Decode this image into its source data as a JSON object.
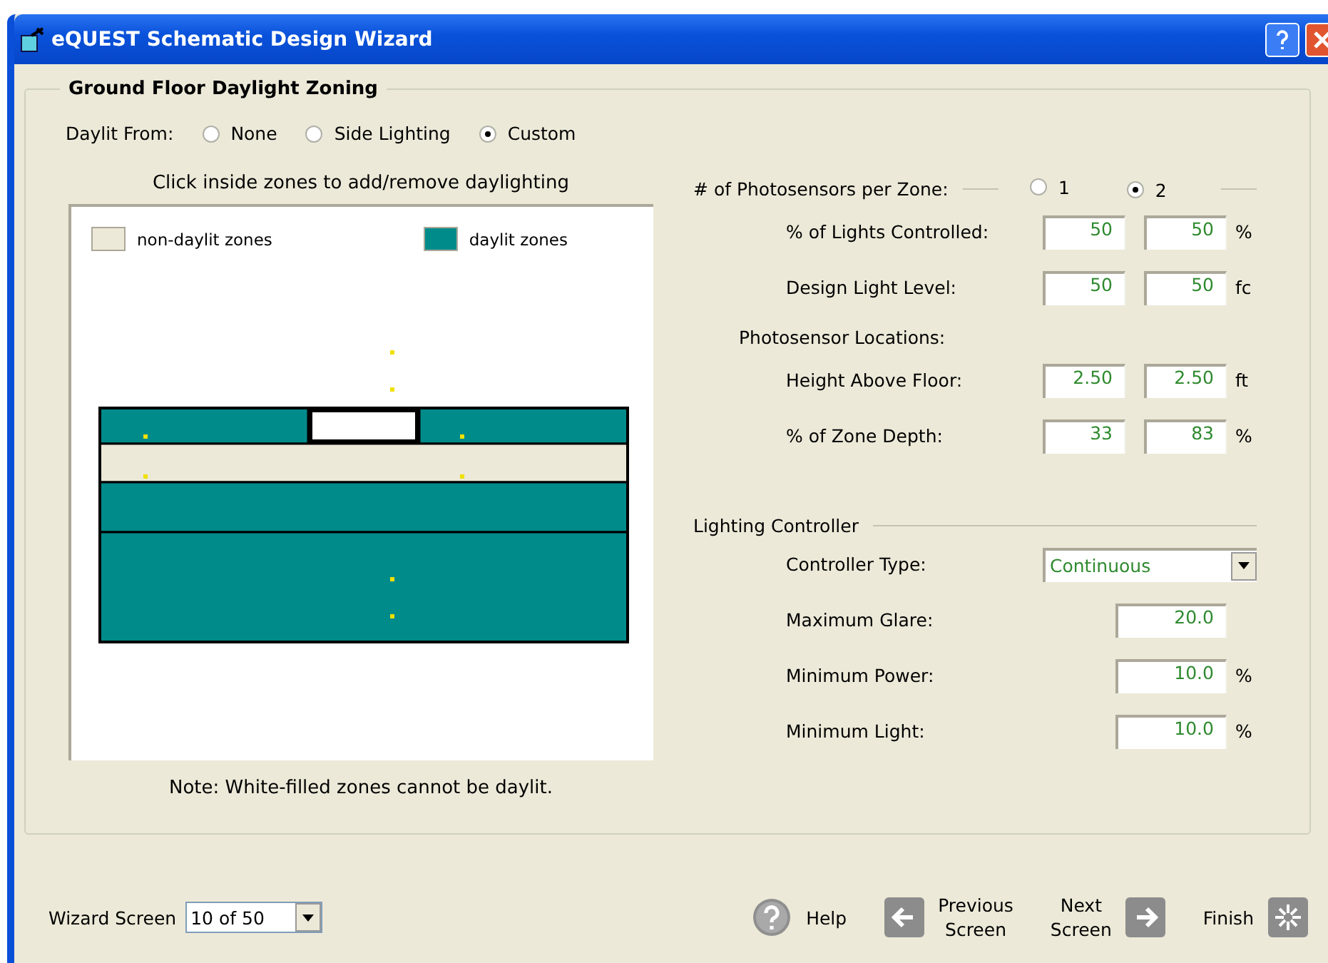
{
  "window": {
    "title": "eQUEST Schematic Design Wizard"
  },
  "group": {
    "title": "Ground Floor Daylight Zoning"
  },
  "daylit_from": {
    "label": "Daylit From:",
    "options": [
      {
        "label": "None",
        "selected": false
      },
      {
        "label": "Side Lighting",
        "selected": false
      },
      {
        "label": "Custom",
        "selected": true
      }
    ]
  },
  "diagram": {
    "caption": "Click inside zones to add/remove daylighting",
    "legend": [
      {
        "label": "non-daylit zones",
        "color": "#ece9d8"
      },
      {
        "label": "daylit zones",
        "color": "#008b8b"
      }
    ],
    "zones": [
      {
        "color": "#008b8b"
      },
      {
        "color": "#ffffff"
      },
      {
        "color": "#008b8b"
      },
      {
        "color": "#ece9d8"
      },
      {
        "color": "#008b8b"
      },
      {
        "color": "#008b8b"
      }
    ],
    "note": "Note:  White-filled zones cannot be daylit."
  },
  "photosensors": {
    "label": "# of Photosensors per Zone:",
    "options": [
      {
        "label": "1",
        "selected": false
      },
      {
        "label": "2",
        "selected": true
      }
    ]
  },
  "sensor_rows": [
    {
      "label": "% of Lights Controlled:",
      "values": [
        "50",
        "50"
      ],
      "unit": "%"
    },
    {
      "label": "Design Light Level:",
      "values": [
        "50",
        "50"
      ],
      "unit": "fc"
    }
  ],
  "locations": {
    "title": "Photosensor Locations:",
    "rows": [
      {
        "label": "Height Above Floor:",
        "values": [
          "2.50",
          "2.50"
        ],
        "unit": "ft"
      },
      {
        "label": "% of Zone Depth:",
        "values": [
          "33",
          "83"
        ],
        "unit": "%"
      }
    ]
  },
  "controller": {
    "title": "Lighting Controller",
    "type": {
      "label": "Controller Type:",
      "value": "Continuous"
    },
    "rows": [
      {
        "label": "Maximum Glare:",
        "value": "20.0"
      },
      {
        "label": "Minimum Power:",
        "value": "10.0",
        "unit": "%"
      },
      {
        "label": "Minimum Light:",
        "value": "10.0",
        "unit": "%"
      }
    ]
  },
  "footer": {
    "wizard_label": "Wizard Screen",
    "wizard_value": "10 of 50",
    "buttons": [
      {
        "kind": "help",
        "lines": [
          "Help"
        ]
      },
      {
        "kind": "previous",
        "lines": [
          "Previous",
          "Screen"
        ]
      },
      {
        "kind": "next",
        "lines": [
          "Next",
          "Screen"
        ]
      },
      {
        "kind": "finish",
        "lines": [
          "Finish"
        ]
      }
    ]
  }
}
